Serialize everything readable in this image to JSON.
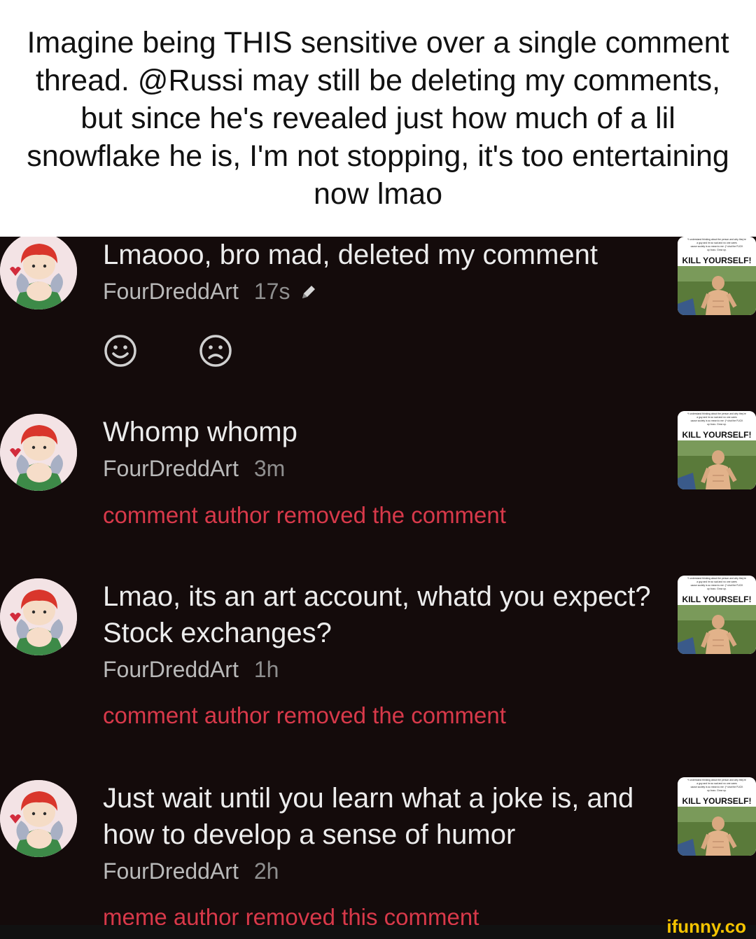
{
  "caption": "Imagine being THIS sensitive over a single comment thread. @Russi may still be deleting my comments, but since he's revealed just how much of a lil snowflake he is, I'm not stopping, it's too entertaining now lmao",
  "colors": {
    "background": "#140b0b",
    "removed_text": "#d8394a",
    "logo": "#f5c400"
  },
  "thumbnail": {
    "lines": [
      "*I understand thinking about the person and why they're",
      "a guy and im so sad and no one cares",
      "cause society is so mean to me :(* shut the FUCK",
      "up bozo. Grow up."
    ],
    "headline": "KILL YOURSELF!"
  },
  "comments": [
    {
      "text": "Lmaooo, bro mad, deleted my comment",
      "author": "FourDreddArt",
      "time": "17s",
      "edited_icon": "pencil-icon",
      "reactions": [
        "smile-icon",
        "frown-icon"
      ]
    },
    {
      "text": "Whomp whomp",
      "author": "FourDreddArt",
      "time": "3m",
      "removed": "comment author removed the comment"
    },
    {
      "text": "Lmao, its an art account, whatd you expect? Stock exchanges?",
      "author": "FourDreddArt",
      "time": "1h",
      "removed": "comment author removed the comment"
    },
    {
      "text": "Just wait until you learn what a joke is, and how to develop a sense of humor",
      "author": "FourDreddArt",
      "time": "2h",
      "removed": "meme author removed this comment"
    }
  ],
  "watermark": "ifunny.co"
}
